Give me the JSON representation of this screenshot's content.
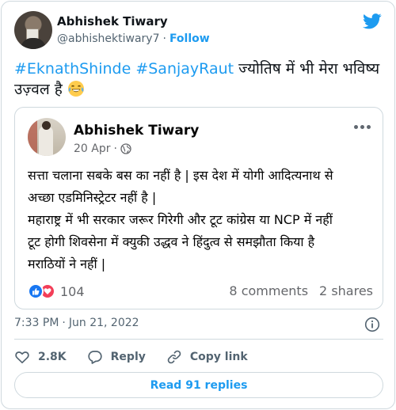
{
  "author": {
    "name": "Abhishek Tiwary",
    "handle": "@abhishektiwary7",
    "separator": "·",
    "follow_label": "Follow"
  },
  "tweet": {
    "hashtag_1": "#EknathShinde",
    "hashtag_2": "#SanjayRaut",
    "text_line1": " ज्योतिष में भी मेरा भविष्य",
    "text_line2": "उज़्वल है ",
    "emoji": "face-with-tears-of-joy"
  },
  "quoted_post": {
    "name": "Abhishek Tiwary",
    "date": "20 Apr",
    "separator": "·",
    "lines": [
      "सत्ता चलाना सबके बस का नहीं है | इस देश में योगी आदित्यनाथ से",
      "अच्छा एडमिनिस्ट्रेटर नहीं है |",
      "महाराष्ट्र में भी सरकार जरूर गिरेगी और टूट कांग्रेस या NCP में नहीं",
      "टूट होगी शिवसेना में क्युकी उद्धव ने हिंदुत्व से समझौता किया है",
      "मराठियों ने नहीं |"
    ],
    "reaction_count": "104",
    "comments": "8 comments",
    "shares": "2 shares"
  },
  "meta": {
    "time": "7:33 PM",
    "separator": "·",
    "date": "Jun 21, 2022"
  },
  "actions": {
    "like_count": "2.8K",
    "reply_label": "Reply",
    "copy_link_label": "Copy link"
  },
  "replies_button": "Read 91 replies",
  "colors": {
    "brand_blue": "#1d9bf0",
    "text": "#0f1419",
    "muted": "#536471",
    "border": "#cfd9de",
    "fb_like": "#1877f2",
    "fb_love": "#f33e58"
  }
}
